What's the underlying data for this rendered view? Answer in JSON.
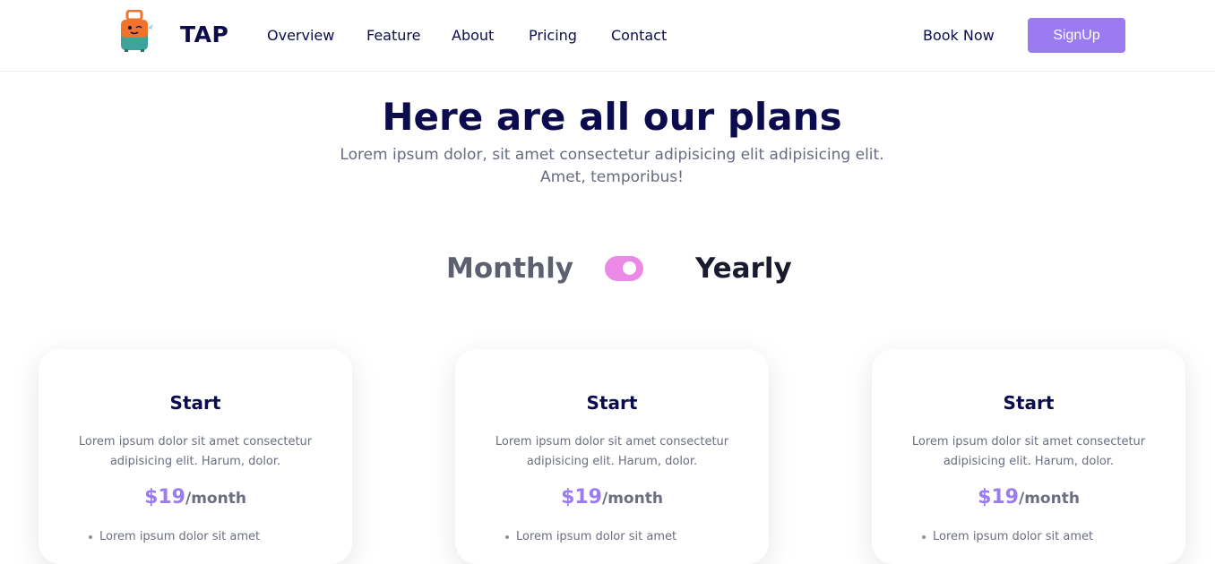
{
  "colors": {
    "accent": "#9b7bf0",
    "toggle": "#ea8ae6",
    "navy": "#0b0b4d",
    "muted": "#6a6e80"
  },
  "nav": {
    "brand": "TAP",
    "links": [
      "Overview",
      "Feature",
      "About",
      "Pricing",
      "Contact"
    ],
    "book_now": "Book Now",
    "signup": "SignUp"
  },
  "hero": {
    "title": "Here are all our plans",
    "subtitle_line1": "Lorem ipsum dolor, sit amet consectetur adipisicing elit adipisicing elit.",
    "subtitle_line2": "Amet, temporibus!"
  },
  "billing": {
    "monthly": "Monthly",
    "yearly": "Yearly",
    "selected": "Yearly"
  },
  "plans": [
    {
      "title": "Start",
      "desc_line1": "Lorem ipsum dolor sit amet consectetur",
      "desc_line2": "adipisicing elit. Harum, dolor.",
      "price": "$19",
      "period": "/month",
      "feature": "Lorem ipsum dolor sit amet"
    },
    {
      "title": "Start",
      "desc_line1": "Lorem ipsum dolor sit amet consectetur",
      "desc_line2": "adipisicing elit. Harum, dolor.",
      "price": "$19",
      "period": "/month",
      "feature": "Lorem ipsum dolor sit amet"
    },
    {
      "title": "Start",
      "desc_line1": "Lorem ipsum dolor sit amet consectetur",
      "desc_line2": "adipisicing elit. Harum, dolor.",
      "price": "$19",
      "period": "/month",
      "feature": "Lorem ipsum dolor sit amet"
    }
  ]
}
